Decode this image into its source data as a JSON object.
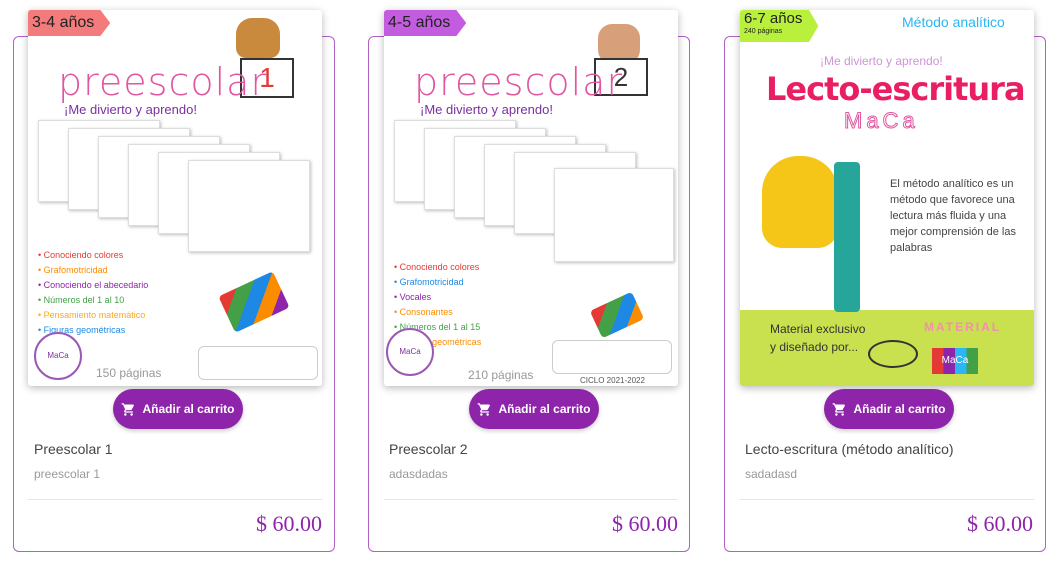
{
  "products": [
    {
      "age_tag": "3-4 años",
      "cover_title": "preescolar",
      "cover_number": "1",
      "cover_subtitle": "¡Me divierto y aprendo!",
      "topics": [
        "Conociendo colores",
        "Grafomotricidad",
        "Conociendo el abecedario",
        "Números del 1 al 10",
        "Pensamiento matemático",
        "Figuras geométricas"
      ],
      "pages": "150 páginas",
      "button": "Añadir al carrito",
      "name": "Preescolar 1",
      "description": "preescolar 1",
      "price": "$ 60.00"
    },
    {
      "age_tag": "4-5 años",
      "cover_title": "preescolar",
      "cover_number": "2",
      "cover_subtitle": "¡Me divierto y aprendo!",
      "topics": [
        "Conociendo colores",
        "Grafomotricidad",
        "Vocales",
        "Consonantes",
        "Números del 1 al 15",
        "Figuras geométricas"
      ],
      "pages": "210 páginas",
      "cycle": "CICLO 2021-2022",
      "button": "Añadir al carrito",
      "name": "Preescolar 2",
      "description": "adasdadas",
      "price": "$ 60.00"
    },
    {
      "age_tag": "6-7 años",
      "age_pages": "240 páginas",
      "method": "Método analítico",
      "cover_subtitle": "¡Me divierto y aprendo!",
      "cover_title": "Lecto-escritura",
      "brand": "MaCa",
      "blurb": "El método analítico es un método que favorece una lectura más fluida y una mejor comprensión de las palabras",
      "exclusive": "Material exclusivo y diseñado por...",
      "material_label": "MATERIAL",
      "button": "Añadir al carrito",
      "name": "Lecto-escritura (método analítico)",
      "description": "sadadasd",
      "price": "$ 60.00"
    }
  ]
}
